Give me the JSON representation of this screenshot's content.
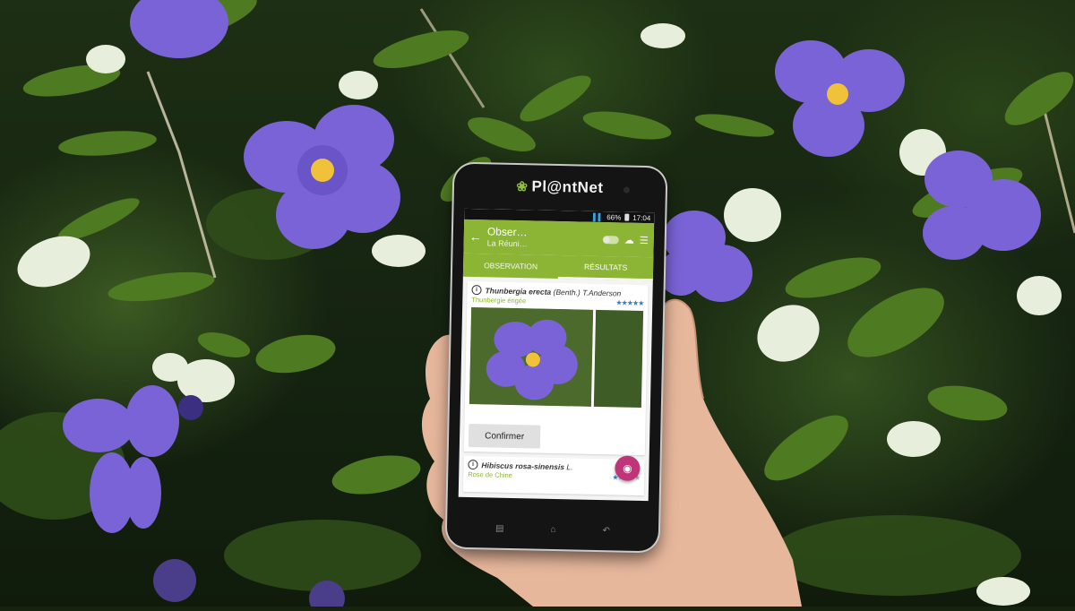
{
  "phone": {
    "brand": "Pl@ntNet",
    "status": {
      "battery": "66%",
      "time": "17:04"
    },
    "appbar": {
      "title": "Obser…",
      "subtitle": "La Réuni…",
      "back_icon": "arrow-left-icon",
      "cloud_icon": "cloud-upload-icon",
      "filter_icon": "filter-icon"
    },
    "tabs": [
      {
        "label": "OBSERVATION"
      },
      {
        "label": "RÉSULTATS",
        "active": true
      }
    ],
    "results": [
      {
        "scientific": "Thunbergia erecta",
        "author": "(Benth.) T.Anderson",
        "common": "Thunbergie érigée",
        "stars": 5
      },
      {
        "scientific": "Hibiscus rosa-sinensis",
        "author": "L.",
        "common": "Rose de Chine",
        "stars": 1
      }
    ],
    "confirm_label": "Confirmer",
    "fab_icon": "camera-add-icon"
  },
  "colors": {
    "accent": "#8db535",
    "fab": "#c0357a",
    "flower": "#7a63d6",
    "stars": "#2f7fc9"
  }
}
